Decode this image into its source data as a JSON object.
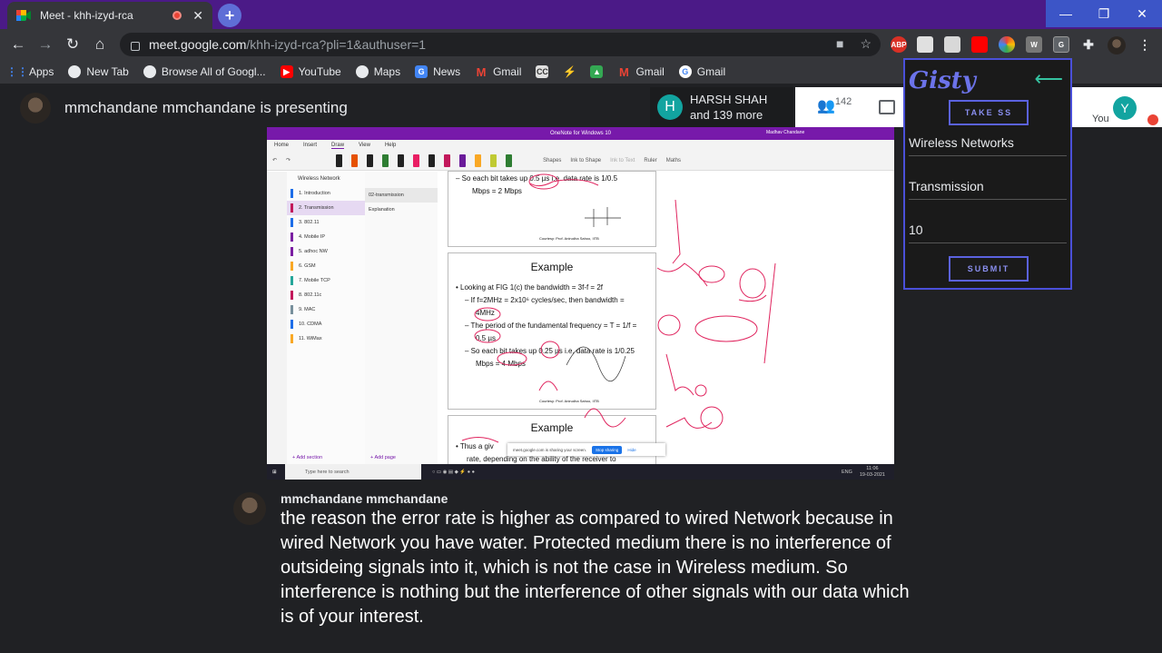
{
  "browser": {
    "tab_title": "Meet - khh-izyd-rca",
    "url_host": "meet.google.com",
    "url_path": "/khh-izyd-rca?pli=1&authuser=1",
    "window_close": "✕",
    "window_min": "—",
    "window_restore": "❐"
  },
  "extensions": {
    "abp": "ABP",
    "w": "W",
    "g": "G"
  },
  "bookmarks": [
    {
      "label": "Apps",
      "icon": "apps-grid-icon"
    },
    {
      "label": "New Tab",
      "icon": "chrome-icon"
    },
    {
      "label": "Browse All of Googl...",
      "icon": "chrome-icon"
    },
    {
      "label": "YouTube",
      "icon": "youtube-icon"
    },
    {
      "label": "Maps",
      "icon": "chrome-icon"
    },
    {
      "label": "News",
      "icon": "google-news-icon"
    },
    {
      "label": "Gmail",
      "icon": "gmail-icon"
    },
    {
      "label": "",
      "icon": "cc-icon"
    },
    {
      "label": "",
      "icon": "power-icon"
    },
    {
      "label": "",
      "icon": "image-icon"
    },
    {
      "label": "Gmail",
      "icon": "gmail-icon"
    },
    {
      "label": "Gmail",
      "icon": "google-icon"
    }
  ],
  "meet": {
    "presenting_text": "mmchandane mmchandane is presenting",
    "participant_name": "HARSH SHAH",
    "participant_more": "and 139 more",
    "participant_initial": "H",
    "people_count": "142",
    "you_initial": "Y",
    "you_label": "You"
  },
  "gisty": {
    "logo": "Gisty",
    "take_ss": "TAKE SS",
    "subject": "Wireless Networks",
    "topic": "Transmission",
    "count": "10",
    "submit": "SUBMIT"
  },
  "shared_screen": {
    "window_title": "OneNote for Windows 10",
    "user": "Madhav Chandane",
    "menu": [
      "Home",
      "Insert",
      "Draw",
      "View",
      "Help"
    ],
    "tools": [
      "Shapes",
      "Ink to Shape",
      "Ink to Text",
      "Ruler",
      "Maths"
    ],
    "notebook": "Wireless Network",
    "sections": [
      {
        "label": "1. Introduction",
        "color": "#1e6ee8"
      },
      {
        "label": "2. Transmission",
        "color": "#c2185b",
        "active": true
      },
      {
        "label": "3. 802.11",
        "color": "#1e6ee8"
      },
      {
        "label": "4. Mobile IP",
        "color": "#7b1fa2"
      },
      {
        "label": "5. adhoc NW",
        "color": "#7b1fa2"
      },
      {
        "label": "6. GSM",
        "color": "#f9a825"
      },
      {
        "label": "7. Mobile TCP",
        "color": "#26a69a"
      },
      {
        "label": "8. 802.11c",
        "color": "#c2185b"
      },
      {
        "label": "9. MAC",
        "color": "#78909c"
      },
      {
        "label": "10. CDMA",
        "color": "#1e6ee8"
      },
      {
        "label": "11. WiMax",
        "color": "#f9a825"
      }
    ],
    "pages": [
      "02-transmission",
      "Explanation"
    ],
    "add_section": "Add section",
    "add_page": "Add page",
    "slide1_lines": [
      "– So each bit takes up 0.5 µs i.e. data rate is 1/0.5",
      "Mbps = 2 Mbps"
    ],
    "slide2_title": "Example",
    "slide2_lines": [
      "• Looking at FIG 1(c) the bandwidth = 3f-f = 2f",
      "– If f=2MHz = 2x10⁶ cycles/sec, then bandwidth =",
      "4MHz",
      "– The period of the fundamental frequency = T = 1/f =",
      "0.5 µs",
      "– So each bit takes up 0.25 µs i.e. data rate is 1/0.25",
      "Mbps = 4 Mbps"
    ],
    "slide3_title": "Example",
    "slide3_lines": [
      "• Thus a giv",
      "rate, depending on the ability of the receiver to"
    ],
    "source": "Courtesy: Prof. Anirudha Sahoo, IITB",
    "share_msg": "meet.google.com is sharing your screen.",
    "stop_sharing": "Stop sharing",
    "hide": "Hide",
    "search_placeholder": "Type here to search",
    "clock_time": "11:06",
    "clock_date": "19-03-2021",
    "lang": "ENG"
  },
  "caption": {
    "speaker": "mmchandane mmchandane",
    "text": "the reason the error rate is higher as compared to wired Network because in wired Network you have water. Protected medium there is no interference of outsideing signals into it, which is not the case in Wireless medium. So interference is nothing but the interference of other signals with our data which is of your interest."
  }
}
